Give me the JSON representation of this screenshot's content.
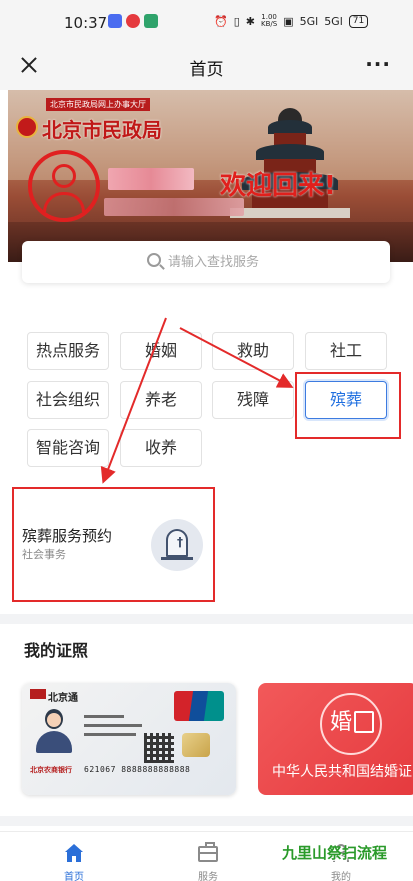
{
  "status_bar": {
    "time": "10:37",
    "rate_top": "1.00",
    "rate_bottom": "KB/S",
    "signal1": "5Gl",
    "signal2": "5Gl",
    "battery": "71"
  },
  "header": {
    "title": "首页"
  },
  "banner": {
    "tag": "北京市民政局网上办事大厅",
    "bureau_name": "北京市民政局",
    "welcome": "欢迎回来!"
  },
  "search": {
    "placeholder": "请输入查找服务"
  },
  "categories": [
    {
      "label": "热点服务"
    },
    {
      "label": "婚姻"
    },
    {
      "label": "救助"
    },
    {
      "label": "社工"
    },
    {
      "label": "社会组织"
    },
    {
      "label": "养老"
    },
    {
      "label": "残障"
    },
    {
      "label": "殡葬"
    },
    {
      "label": "智能咨询"
    },
    {
      "label": "收养"
    }
  ],
  "service_card": {
    "title": "殡葬服务预约",
    "subtitle": "社会事务"
  },
  "certificates": {
    "title": "我的证照",
    "social_card": {
      "brand": "北京通",
      "number": "621067 8888888888888",
      "bank": "北京农商银行"
    },
    "marriage_card": {
      "glyph": "婚",
      "label": "中华人民共和国结婚证"
    }
  },
  "bottom_nav": [
    {
      "label": "首页"
    },
    {
      "label": "服务"
    },
    {
      "label": "我的"
    }
  ],
  "watermark": "九里山祭扫流程",
  "colors": {
    "accent": "#2b6fd8",
    "highlight_frame": "#e32a2a",
    "marriage_card": "#e53a3e"
  }
}
